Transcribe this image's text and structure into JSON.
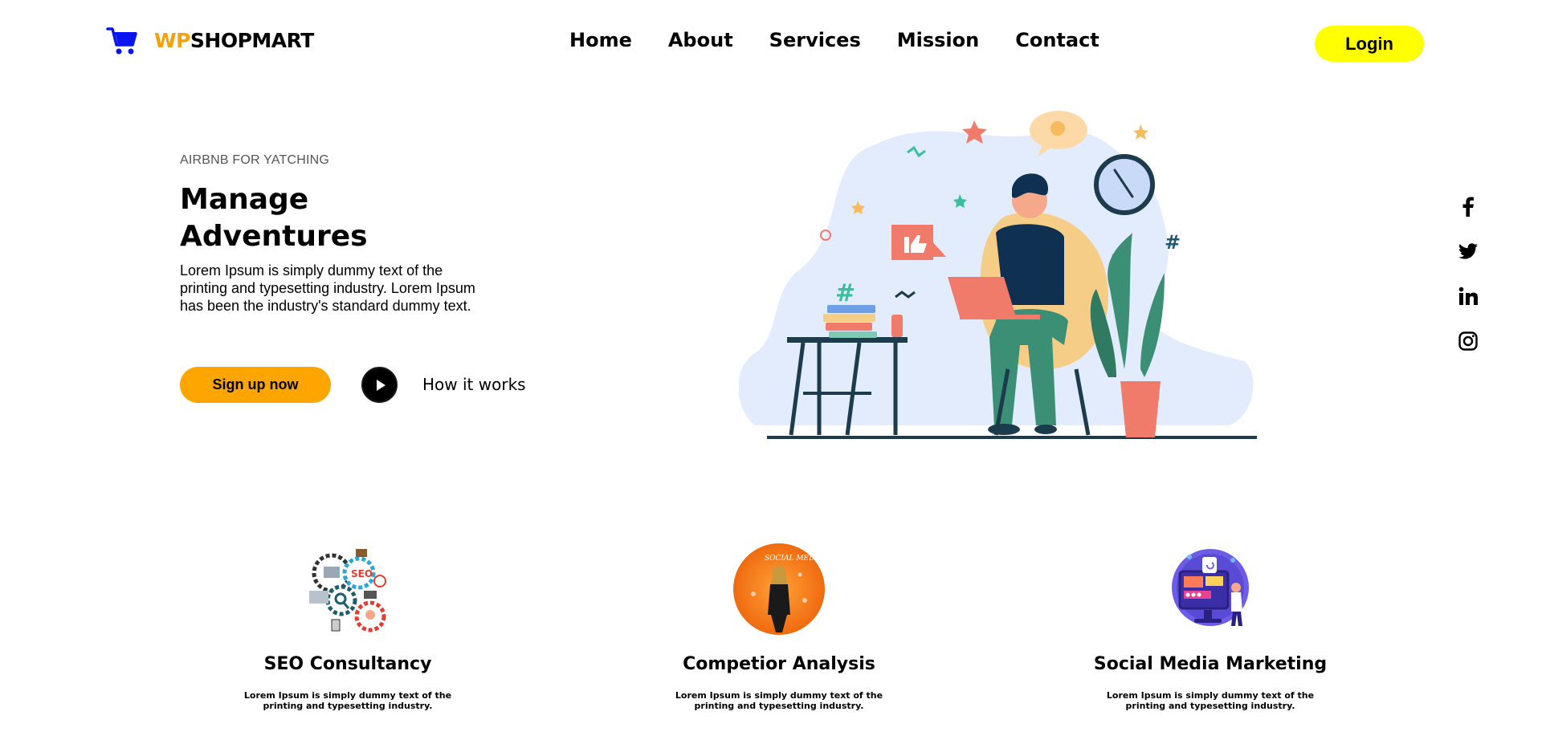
{
  "header": {
    "logo": {
      "icon": "shopping-cart-icon",
      "brand_prefix": "WP",
      "brand_suffix": "SHOPMART",
      "prefix_color": "#f5a20a",
      "icon_color": "#0a14f0"
    },
    "nav": [
      {
        "label": "Home"
      },
      {
        "label": "About"
      },
      {
        "label": "Services"
      },
      {
        "label": "Mission"
      },
      {
        "label": "Contact"
      }
    ],
    "login_label": "Login",
    "login_color": "#ffff00"
  },
  "hero": {
    "eyebrow": "AIRBNB FOR YATCHING",
    "title": "Manage Adventures",
    "description": "Lorem Ipsum is simply dummy text of the printing and typesetting industry. Lorem Ipsum has been the industry's standard dummy text.",
    "signup_label": "Sign up now",
    "signup_color": "#ffa500",
    "how_it_works_label": "How it works",
    "illustration": "person-with-laptop-illustration"
  },
  "social": [
    {
      "icon": "facebook-icon"
    },
    {
      "icon": "twitter-icon"
    },
    {
      "icon": "linkedin-icon"
    },
    {
      "icon": "instagram-icon"
    }
  ],
  "features": [
    {
      "image": "seo-gears-image",
      "title": "SEO Consultancy",
      "description": "Lorem Ipsum is simply dummy text of the printing and typesetting industry."
    },
    {
      "image": "social-media-woman-image",
      "title": "Competior Analysis",
      "description": "Lorem Ipsum is simply dummy text of the printing and typesetting industry."
    },
    {
      "image": "social-media-marketing-image",
      "title": "Social Media Marketing",
      "description": "Lorem Ipsum is simply dummy text of the printing and typesetting industry."
    }
  ]
}
